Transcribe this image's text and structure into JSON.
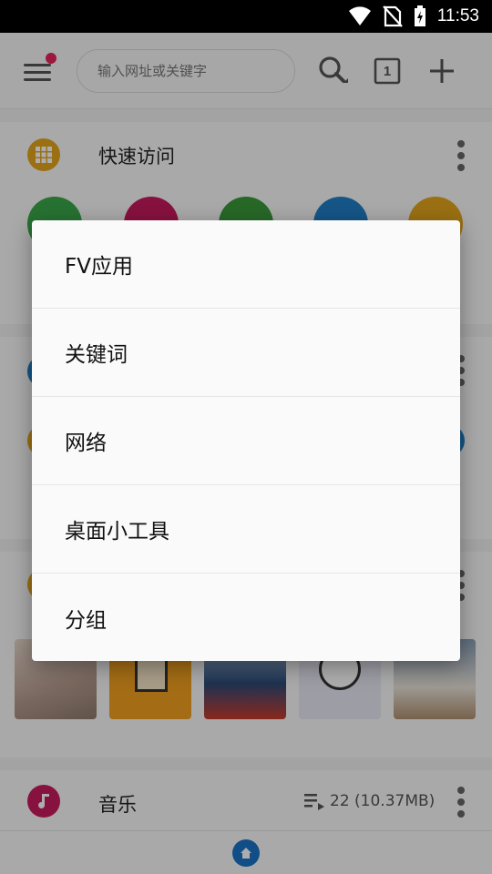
{
  "status_bar": {
    "time": "11:53",
    "icons": [
      "wifi-icon",
      "no-sim-icon",
      "battery-charging-icon"
    ]
  },
  "toolbar": {
    "search_placeholder": "输入网址或关键字",
    "tab_count": "1",
    "icons": [
      "menu-icon",
      "search-icon",
      "tabs-icon",
      "add-icon"
    ]
  },
  "quick_access": {
    "title": "快速访问",
    "icon": "apps-grid-icon",
    "icon_color": "#e3a51d",
    "app_colors": [
      "#3aa84a",
      "#c81a5e",
      "#3a9a3a",
      "#1f7fc8",
      "#e3a51d"
    ]
  },
  "music": {
    "title": "音乐",
    "icon": "music-note-icon",
    "icon_color": "#c81a5e",
    "count_text": "22 (10.37MB)"
  },
  "thumbnails": [
    {
      "name": "thumb-photo",
      "color": "#c9b7a9"
    },
    {
      "name": "thumb-pixel-character",
      "color": "#f0a020"
    },
    {
      "name": "thumb-bus",
      "color": "#2c4a78"
    },
    {
      "name": "thumb-cartoon",
      "color": "#e8e8f4"
    },
    {
      "name": "thumb-rally-car",
      "color": "#8aa0b8"
    }
  ],
  "dialog": {
    "items": [
      {
        "label": "FV应用"
      },
      {
        "label": "关键词"
      },
      {
        "label": "网络"
      },
      {
        "label": "桌面小工具"
      },
      {
        "label": "分组"
      }
    ]
  },
  "colors": {
    "accent_blue": "#1a73c7",
    "badge_red": "#e8245a"
  }
}
